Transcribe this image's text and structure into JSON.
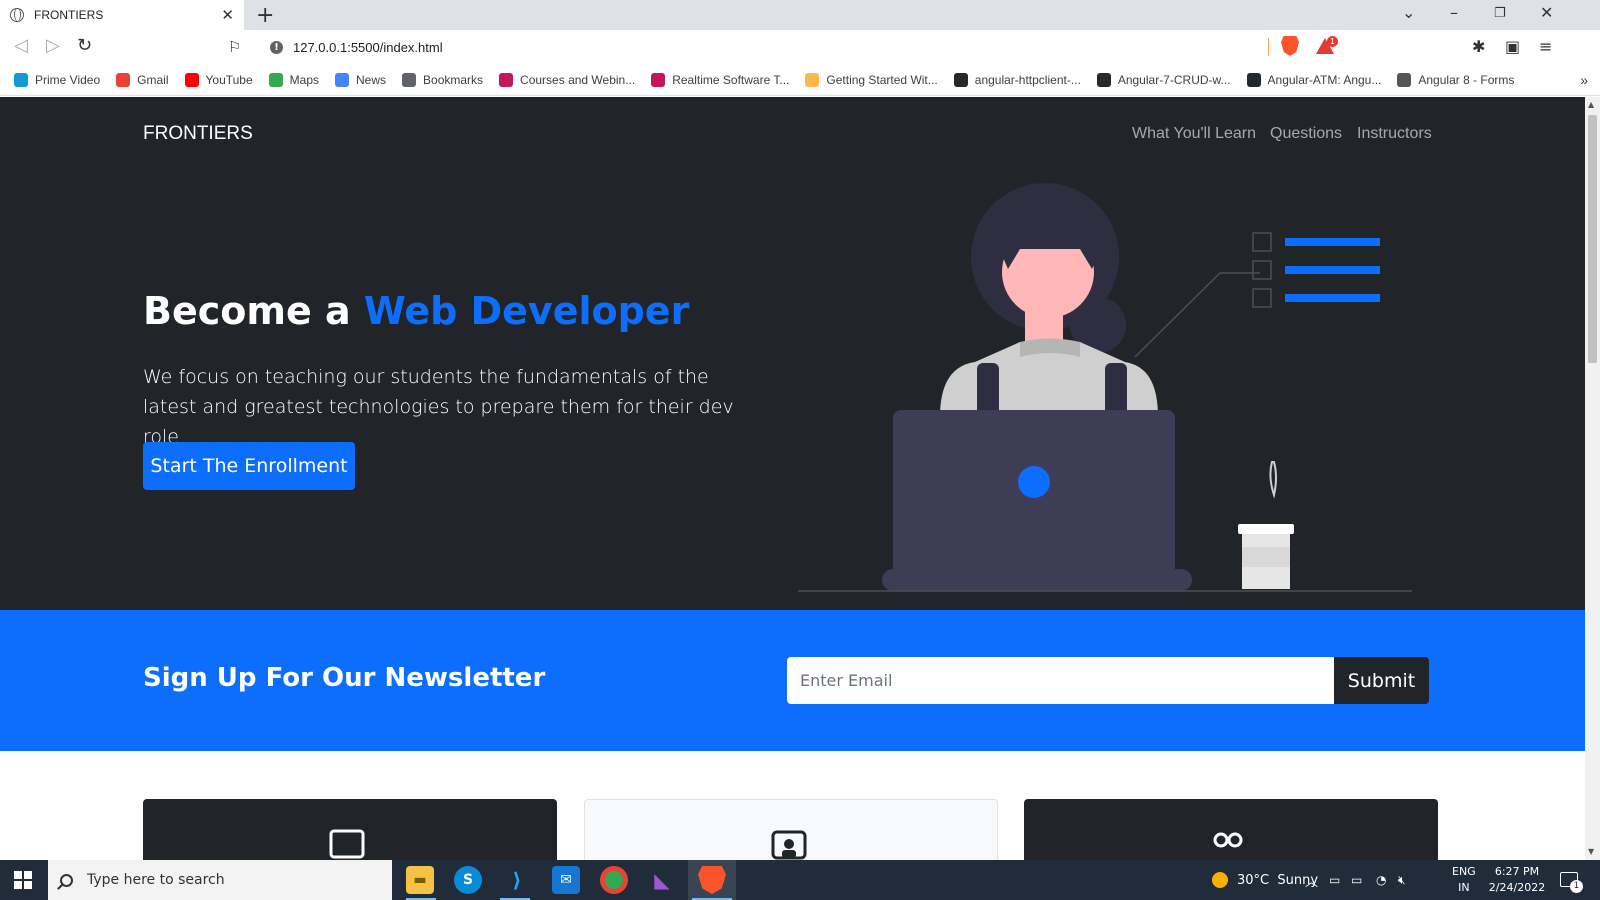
{
  "browser": {
    "tab_title": "FRONTIERS",
    "url": "127.0.0.1:5500/index.html",
    "reward_badge": "1",
    "bookmarks": [
      {
        "label": "Prime Video",
        "icon": "prime-video-icon",
        "color": "#1399d4"
      },
      {
        "label": "Gmail",
        "icon": "gmail-icon",
        "color": "#ea4335"
      },
      {
        "label": "YouTube",
        "icon": "youtube-icon",
        "color": "#ff0000"
      },
      {
        "label": "Maps",
        "icon": "maps-icon",
        "color": "#34a853"
      },
      {
        "label": "News",
        "icon": "news-icon",
        "color": "#4285f4"
      },
      {
        "label": "Bookmarks",
        "icon": "bookmarks-icon",
        "color": "#5f6368"
      },
      {
        "label": "Courses and Webin...",
        "icon": "dotnet-icon",
        "color": "#c2185b"
      },
      {
        "label": "Realtime Software T...",
        "icon": "dotnet-icon",
        "color": "#c2185b"
      },
      {
        "label": "Getting Started Wit...",
        "icon": "hand-icon",
        "color": "#ffb74d"
      },
      {
        "label": "angular-httpclient-...",
        "icon": "github-icon",
        "color": "#24292e"
      },
      {
        "label": "Angular-7-CRUD-w...",
        "icon": "github-icon",
        "color": "#24292e"
      },
      {
        "label": "Angular-ATM: Angu...",
        "icon": "github-icon",
        "color": "#24292e"
      },
      {
        "label": "Angular 8 - Forms",
        "icon": "angular-icon",
        "color": "#555555"
      }
    ]
  },
  "page": {
    "brand": "FRONTIERS",
    "nav": {
      "learn": "What You'll Learn",
      "questions": "Questions",
      "instructors": "Instructors"
    },
    "hero": {
      "title_prefix": "Become a ",
      "title_accent": "Web Developer",
      "text": "We focus on teaching our students the fundamentals of the latest and greatest technologies to prepare them for their dev role",
      "button": "Start The Enrollment"
    },
    "newsletter": {
      "title": "Sign Up For Our Newsletter",
      "placeholder": "Enter Email",
      "submit": "Submit"
    },
    "colors": {
      "accent": "#0d6efd",
      "dark": "#212529"
    }
  },
  "taskbar": {
    "search_placeholder": "Type here to search",
    "weather": "30°C  Sunny",
    "lang_top": "ENG",
    "lang_bottom": "IN",
    "time": "6:27 PM",
    "date": "2/24/2022",
    "notifications": "1"
  }
}
